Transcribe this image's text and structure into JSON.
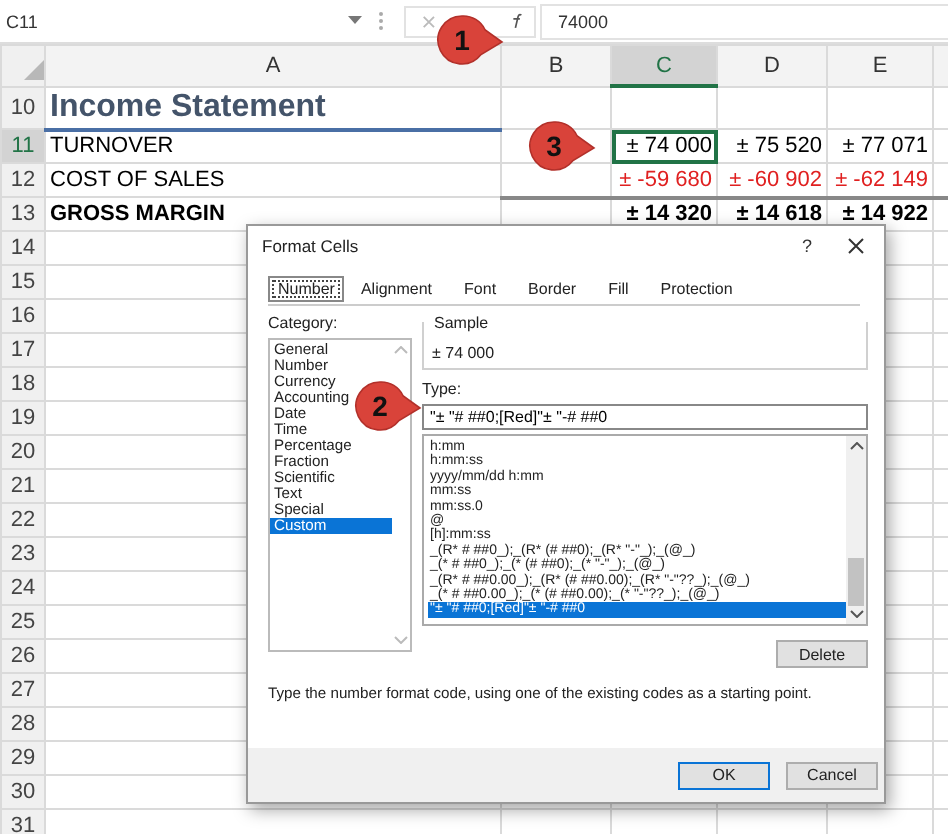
{
  "formula_bar": {
    "name_box": "C11",
    "formula": "74000"
  },
  "sheet": {
    "columns": [
      {
        "label": "A",
        "selected": false
      },
      {
        "label": "B",
        "selected": false
      },
      {
        "label": "C",
        "selected": true
      },
      {
        "label": "D",
        "selected": false
      },
      {
        "label": "E",
        "selected": false
      }
    ],
    "rows": [
      {
        "number": "10",
        "selected": false,
        "kind": "title",
        "label": "Income Statement"
      },
      {
        "number": "11",
        "selected": true,
        "kind": "plain",
        "label": "TURNOVER",
        "values": [
          "± 74 000",
          "± 75 520",
          "± 77 071"
        ]
      },
      {
        "number": "12",
        "selected": false,
        "kind": "negative",
        "label": "COST OF SALES",
        "values": [
          "± -59 680",
          "± -60 902",
          "± -62 149"
        ]
      },
      {
        "number": "13",
        "selected": false,
        "kind": "total",
        "label": "GROSS MARGIN",
        "values": [
          "± 14 320",
          "± 14 618",
          "± 14 922"
        ]
      },
      {
        "number": "14",
        "selected": false,
        "kind": "blank"
      },
      {
        "number": "15",
        "selected": false,
        "kind": "blank"
      },
      {
        "number": "16",
        "selected": false,
        "kind": "blank"
      },
      {
        "number": "17",
        "selected": false,
        "kind": "blank"
      },
      {
        "number": "18",
        "selected": false,
        "kind": "blank"
      },
      {
        "number": "19",
        "selected": false,
        "kind": "blank"
      },
      {
        "number": "20",
        "selected": false,
        "kind": "blank"
      },
      {
        "number": "21",
        "selected": false,
        "kind": "blank"
      },
      {
        "number": "22",
        "selected": false,
        "kind": "blank"
      },
      {
        "number": "23",
        "selected": false,
        "kind": "blank"
      },
      {
        "number": "24",
        "selected": false,
        "kind": "blank"
      },
      {
        "number": "25",
        "selected": false,
        "kind": "blank"
      },
      {
        "number": "26",
        "selected": false,
        "kind": "blank"
      },
      {
        "number": "27",
        "selected": false,
        "kind": "blank"
      },
      {
        "number": "28",
        "selected": false,
        "kind": "blank"
      },
      {
        "number": "29",
        "selected": false,
        "kind": "blank"
      },
      {
        "number": "30",
        "selected": false,
        "kind": "blank"
      },
      {
        "number": "31",
        "selected": false,
        "kind": "blank"
      }
    ]
  },
  "dialog": {
    "title": "Format Cells",
    "help": "?",
    "tabs": [
      {
        "label": "Number",
        "selected": true
      },
      {
        "label": "Alignment",
        "selected": false
      },
      {
        "label": "Font",
        "selected": false
      },
      {
        "label": "Border",
        "selected": false
      },
      {
        "label": "Fill",
        "selected": false
      },
      {
        "label": "Protection",
        "selected": false
      }
    ],
    "category_label": "Category:",
    "categories": [
      {
        "label": "General",
        "selected": false
      },
      {
        "label": "Number",
        "selected": false
      },
      {
        "label": "Currency",
        "selected": false
      },
      {
        "label": "Accounting",
        "selected": false
      },
      {
        "label": "Date",
        "selected": false
      },
      {
        "label": "Time",
        "selected": false
      },
      {
        "label": "Percentage",
        "selected": false
      },
      {
        "label": "Fraction",
        "selected": false
      },
      {
        "label": "Scientific",
        "selected": false
      },
      {
        "label": "Text",
        "selected": false
      },
      {
        "label": "Special",
        "selected": false
      },
      {
        "label": "Custom",
        "selected": true
      }
    ],
    "sample": {
      "label": "Sample",
      "value": "± 74 000"
    },
    "type": {
      "label": "Type:",
      "value": "\"± \"# ##0;[Red]\"± \"-# ##0"
    },
    "type_list": [
      {
        "label": "h:mm",
        "selected": false
      },
      {
        "label": "h:mm:ss",
        "selected": false
      },
      {
        "label": "yyyy/mm/dd h:mm",
        "selected": false
      },
      {
        "label": "mm:ss",
        "selected": false
      },
      {
        "label": "mm:ss.0",
        "selected": false
      },
      {
        "label": "@",
        "selected": false
      },
      {
        "label": "[h]:mm:ss",
        "selected": false
      },
      {
        "label": "_(R* # ##0_);_(R* (# ##0);_(R* \"-\"_);_(@_)",
        "selected": false
      },
      {
        "label": "_(* # ##0_);_(* (# ##0);_(* \"-\"_);_(@_)",
        "selected": false
      },
      {
        "label": "_(R* # ##0.00_);_(R* (# ##0.00);_(R* \"-\"??_);_(@_)",
        "selected": false
      },
      {
        "label": "_(* # ##0.00_);_(* (# ##0.00);_(* \"-\"??_);_(@_)",
        "selected": false
      },
      {
        "label": "\"± \"# ##0;[Red]\"± \"-# ##0",
        "selected": true
      }
    ],
    "delete": "Delete",
    "description": "Type the number format code, using one of the existing codes as a starting point.",
    "ok": "OK",
    "cancel": "Cancel"
  },
  "callouts": [
    {
      "number": "1"
    },
    {
      "number": "2"
    },
    {
      "number": "3"
    }
  ]
}
